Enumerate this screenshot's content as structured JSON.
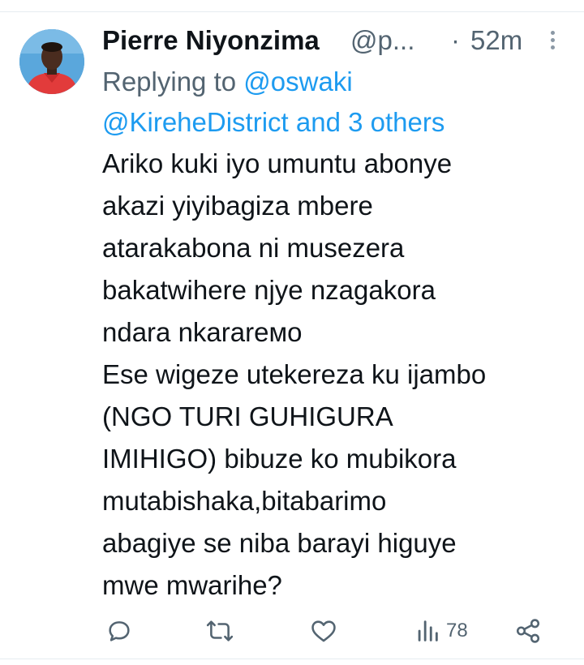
{
  "tweet": {
    "display_name": "Pierre Niyonzima",
    "handle": "@p...",
    "separator": "·",
    "time": "52m",
    "replying_prefix": "Replying to",
    "replying_line1_mention": "@oswaki",
    "replying_line2_mention": "@KireheDistrict",
    "replying_and": "and",
    "replying_others": "3 others",
    "body": "Ariko kuki iyo umuntu abonye\nakazi yiyibagiza mbere\natarakabona ni musezera\nbakatwihere njye nzagakora\nndara nkarareмо\nEse wigeze utekereza ku ijambo\n(NGO TURI GUHIGURA\nIMIHIGO) bibuze ko mubikora\nmutabishaka,bitabarimo\nabagiye se niba barayi higuye\nmwe mwarihe?",
    "views_count": "78"
  },
  "icons": {
    "reply": "reply-icon",
    "retweet": "retweet-icon",
    "like": "like-icon",
    "views": "views-icon",
    "share": "share-icon",
    "more": "more-vertical-icon"
  },
  "colors": {
    "link": "#1d9bf0",
    "muted": "#536471",
    "text": "#0f1419"
  }
}
